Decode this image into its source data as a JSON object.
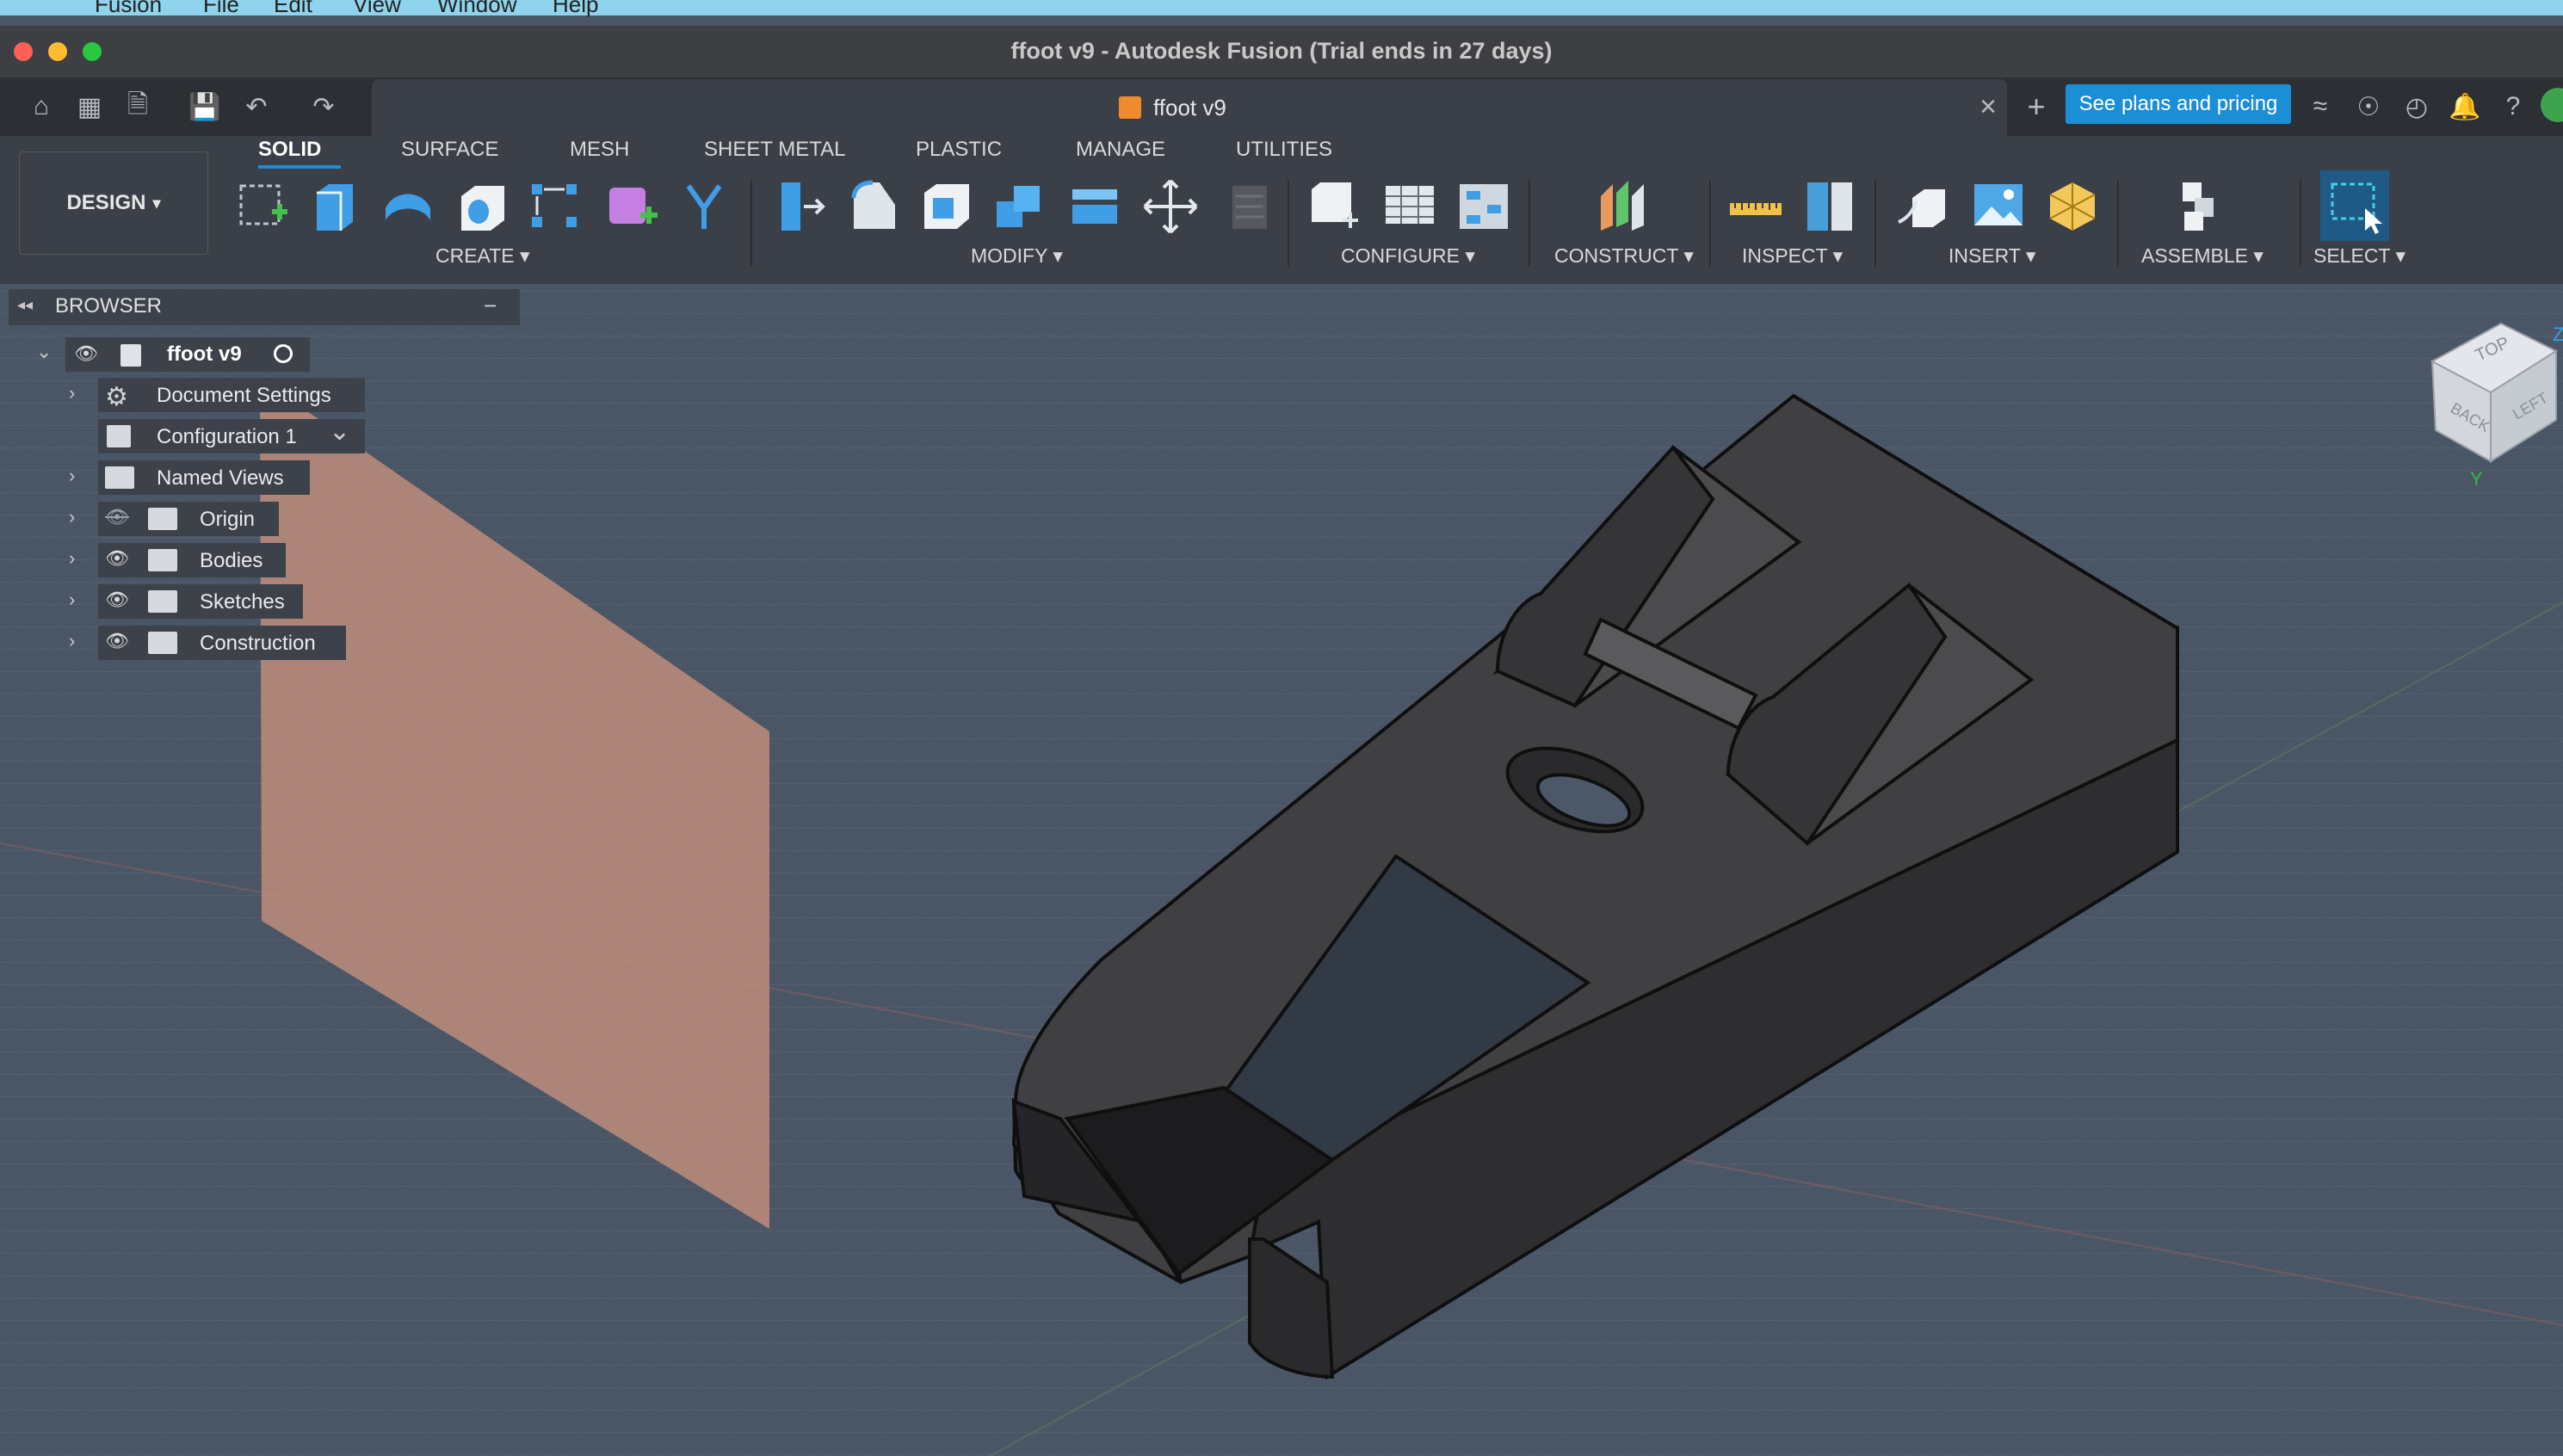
{
  "mac_menu": {
    "items": [
      "Fusion",
      "File",
      "Edit",
      "View",
      "Window",
      "Help"
    ]
  },
  "window": {
    "title": "ffoot v9 - Autodesk Fusion (Trial ends in 27 days)"
  },
  "document_tab": {
    "title": "ffoot v9",
    "close": "×",
    "new": "+"
  },
  "plans_button": "See plans and pricing",
  "workspace": {
    "label": "DESIGN",
    "caret": "▾"
  },
  "ribbon_tabs": [
    "SOLID",
    "SURFACE",
    "MESH",
    "SHEET METAL",
    "PLASTIC",
    "MANAGE",
    "UTILITIES"
  ],
  "ribbon_groups": [
    "CREATE ▾",
    "MODIFY ▾",
    "CONFIGURE ▾",
    "CONSTRUCT ▾",
    "INSPECT ▾",
    "INSERT ▾",
    "ASSEMBLE ▾",
    "SELECT ▾"
  ],
  "browser": {
    "title": "BROWSER",
    "collapse": "−",
    "root": "ffoot v9",
    "items": [
      {
        "label": "Document Settings",
        "icon": "gear-icon"
      },
      {
        "label": "Configuration 1",
        "icon": "config-icon"
      },
      {
        "label": "Named Views",
        "icon": "folder-icon"
      },
      {
        "label": "Origin",
        "icon": "folder-icon",
        "hidden": true
      },
      {
        "label": "Bodies",
        "icon": "folder-icon"
      },
      {
        "label": "Sketches",
        "icon": "folder-icon"
      },
      {
        "label": "Construction",
        "icon": "folder-icon"
      }
    ]
  },
  "viewcube": {
    "faces": [
      "TOP",
      "BACK",
      "LEFT"
    ],
    "axes": [
      "Z",
      "Y"
    ]
  },
  "colors": {
    "accent": "#1c8de0",
    "viewport_bg": "#4a5666",
    "model": "#3c3c3e",
    "plane": "#c9917e"
  }
}
